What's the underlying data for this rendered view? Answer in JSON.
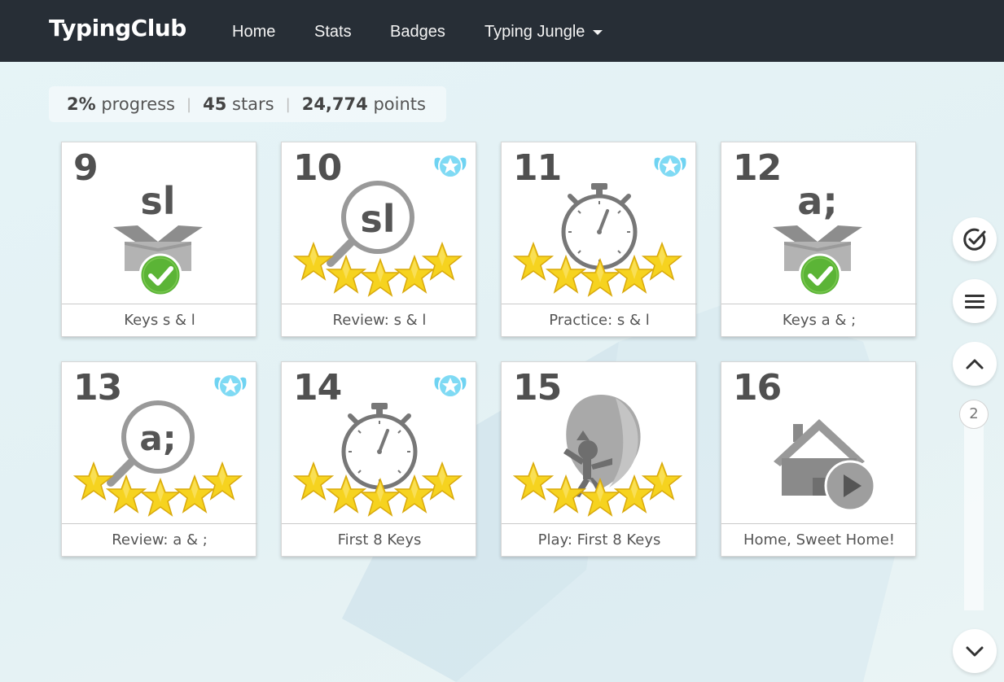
{
  "navbar": {
    "brand": "TypingClub",
    "links": [
      "Home",
      "Stats",
      "Badges",
      "Typing Jungle"
    ]
  },
  "stats": {
    "progress_value": "2%",
    "progress_label": "progress",
    "stars_value": "45",
    "stars_label": "stars",
    "points_value": "24,774",
    "points_label": "points",
    "separator": "|"
  },
  "lessons": [
    {
      "number": "9",
      "title": "Keys s & l",
      "art": "new-key-box",
      "keys": "sl",
      "stars": 0,
      "badge": false,
      "completed": true
    },
    {
      "number": "10",
      "title": "Review: s & l",
      "art": "review-magnifier",
      "keys": "sl",
      "stars": 5,
      "badge": true,
      "completed": true
    },
    {
      "number": "11",
      "title": "Practice: s & l",
      "art": "stopwatch",
      "stars": 5,
      "badge": true,
      "completed": true
    },
    {
      "number": "12",
      "title": "Keys a & ;",
      "art": "new-key-box",
      "keys": "a;",
      "stars": 0,
      "badge": false,
      "completed": true
    },
    {
      "number": "13",
      "title": "Review: a & ;",
      "art": "review-magnifier",
      "keys": "a;",
      "stars": 5,
      "badge": true,
      "completed": true
    },
    {
      "number": "14",
      "title": "First 8 Keys",
      "art": "stopwatch",
      "stars": 5,
      "badge": true,
      "completed": true
    },
    {
      "number": "15",
      "title": "Play: First 8 Keys",
      "art": "balloon-game",
      "stars": 5,
      "badge": false,
      "completed": true
    },
    {
      "number": "16",
      "title": "Home, Sweet Home!",
      "art": "house-video",
      "stars": 0,
      "badge": false,
      "completed": false
    }
  ],
  "sidebar": {
    "page_number": "2",
    "buttons": [
      "check-circle-icon",
      "menu-icon",
      "chevron-up-icon",
      "chevron-down-icon"
    ]
  },
  "colors": {
    "navbar": "#272e36",
    "star": "#f6d31f",
    "check_green": "#5bb436",
    "badge_blue": "#6fd3f2",
    "icon_gray": "#8a8a8a"
  }
}
